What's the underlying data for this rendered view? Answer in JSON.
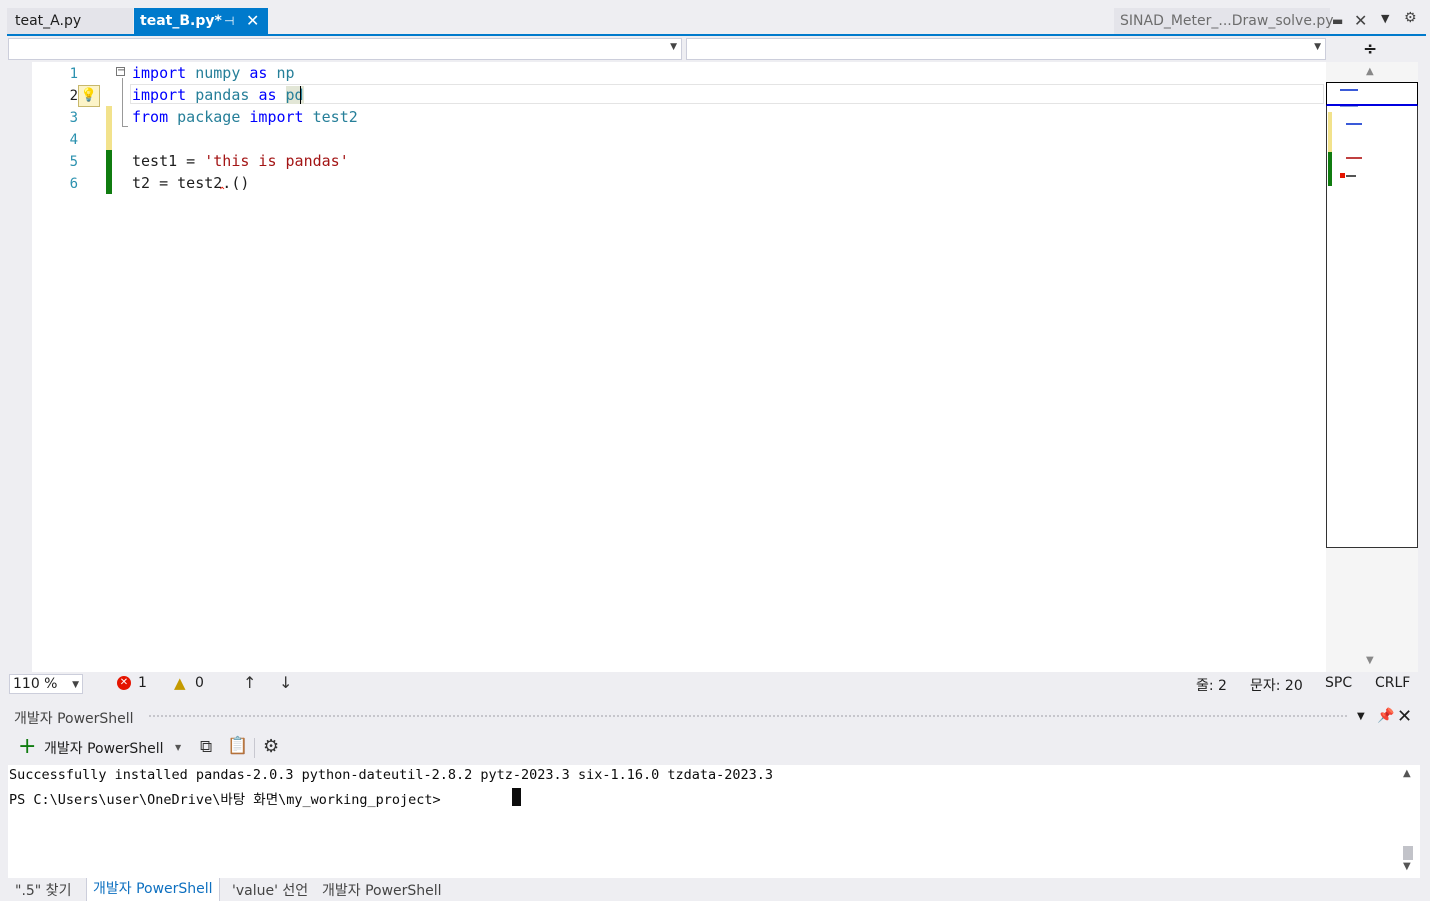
{
  "tabs": {
    "file_a": "teat_A.py",
    "file_b": "teat_B.py*",
    "file_c": "SINAD_Meter_...Draw_solve.py",
    "pin_glyph": "⊣",
    "close_glyph": "✕"
  },
  "editor": {
    "line_numbers": [
      "1",
      "2",
      "3",
      "4",
      "5",
      "6"
    ],
    "lines": [
      {
        "kw1": "import",
        "mod": " numpy ",
        "kw2": "as",
        "rest": " np"
      },
      {
        "kw1": "import",
        "mod": " pandas ",
        "kw2": "as",
        "pre": " ",
        "hl": "pd"
      },
      {
        "kw1": "from",
        "mod": " package ",
        "kw2": "import",
        "rest": " test2"
      },
      {},
      {
        "name": "test1",
        "op": " = ",
        "str": "'this is pandas'"
      },
      {
        "name": "t2",
        "op": " = ",
        "rest": "test2.()"
      }
    ],
    "colors": {
      "keyword": "#0000ff",
      "module": "#267f99",
      "string": "#a31515",
      "changed": "#107c10",
      "unsaved": "#f2e28c"
    }
  },
  "status": {
    "zoom": "110 %",
    "errors": "1",
    "warnings": "0",
    "line": "줄: 2",
    "col": "문자: 20",
    "indent": "SPC",
    "eol": "CRLF"
  },
  "terminal": {
    "panel_title": "개발자 PowerShell",
    "profile": "개발자 PowerShell",
    "output": [
      "Successfully installed pandas-2.0.3 python-dateutil-2.8.2 pytz-2023.3 six-1.16.0 tzdata-2023.3",
      "PS C:\\Users\\user\\OneDrive\\바탕 화면\\my_working_project> "
    ]
  },
  "bottom_tabs": {
    "find": "\".5\" 찾기",
    "powershell": "개발자 PowerShell",
    "value_decl": "'value' 선언",
    "powershell2": "개발자 PowerShell"
  },
  "icons": {
    "fold": "minus-box-icon",
    "bulb": "lightbulb-icon",
    "error": "error-circle-icon",
    "warning": "warning-triangle-icon",
    "new_terminal": "plus-icon",
    "copy": "copy-icon",
    "paste": "paste-icon",
    "settings": "gear-icon"
  }
}
